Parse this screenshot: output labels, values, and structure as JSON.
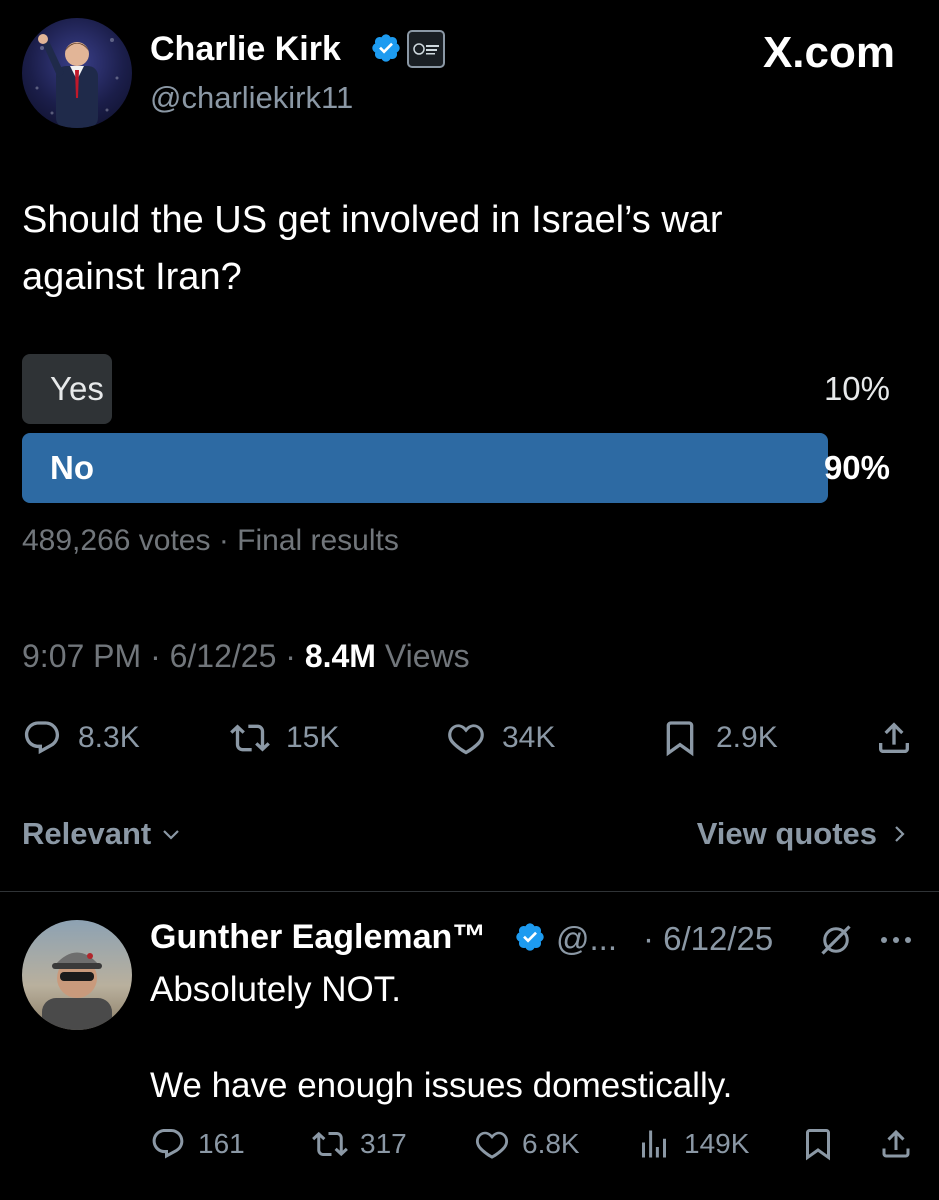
{
  "brand": "X.com",
  "author": {
    "name": "Charlie Kirk",
    "handle": "@charliekirk11"
  },
  "tweet": {
    "line1": "Should the US get involved in Israel’s war",
    "line2": "against Iran?"
  },
  "poll": {
    "options": [
      {
        "label": "Yes",
        "percent_text": "10%",
        "percent": 10,
        "winner": false
      },
      {
        "label": "No",
        "percent_text": "90%",
        "percent": 90,
        "winner": true
      }
    ],
    "meta": "489,266 votes · Final results"
  },
  "timestamp": {
    "time_date": "9:07 PM · 6/12/25 · ",
    "views_count": "8.4M",
    "views_label": " Views"
  },
  "actions": {
    "replies": "8.3K",
    "reposts": "15K",
    "likes": "34K",
    "bookmarks": "2.9K"
  },
  "sort": {
    "label": "Relevant",
    "view_quotes": "View quotes"
  },
  "reply": {
    "name": "Gunther Eagleman™",
    "handle": "@...",
    "date": "· 6/12/25",
    "line1": "Absolutely NOT.",
    "line2": "We have enough issues domestically.",
    "replies": "161",
    "reposts": "317",
    "likes": "6.8K",
    "views": "149K"
  },
  "colors": {
    "background": "#000000",
    "poll_winner": "#2d6aa3",
    "poll_other": "#2f3336",
    "verified": "#1d9bf0",
    "muted_text": "#71767b"
  }
}
